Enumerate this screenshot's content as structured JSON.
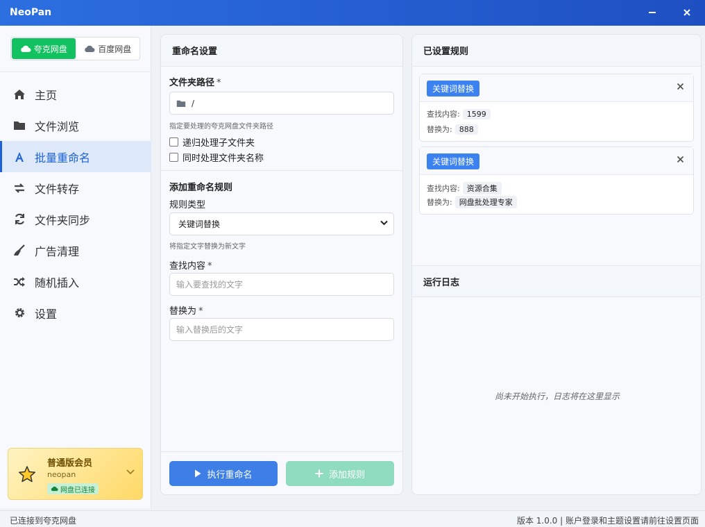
{
  "app": {
    "title": "NeoPan"
  },
  "cloud_switch": {
    "quark": "夸克网盘",
    "baidu": "百度网盘"
  },
  "nav": [
    {
      "label": "主页",
      "icon": "home-icon"
    },
    {
      "label": "文件浏览",
      "icon": "folder-icon"
    },
    {
      "label": "批量重命名",
      "icon": "font-icon",
      "active": true
    },
    {
      "label": "文件转存",
      "icon": "exchange-icon"
    },
    {
      "label": "文件夹同步",
      "icon": "sync-icon"
    },
    {
      "label": "广告清理",
      "icon": "broom-icon"
    },
    {
      "label": "随机插入",
      "icon": "shuffle-icon"
    },
    {
      "label": "设置",
      "icon": "gear-icon"
    }
  ],
  "member": {
    "title": "普通版会员",
    "user": "neopan",
    "badge": "网盘已连接"
  },
  "rename": {
    "title": "重命名设置",
    "folder_label": "文件夹路径",
    "folder_value": "/",
    "folder_hint": "指定要处理的夸克网盘文件夹路径",
    "recursive": "递归处理子文件夹",
    "include_folders": "同时处理文件夹名称",
    "add_rule_title": "添加重命名规则",
    "rule_type_label": "规则类型",
    "rule_type_value": "关键词替换",
    "rule_type_hint": "将指定文字替换为新文字",
    "find_label": "查找内容",
    "find_placeholder": "输入要查找的文字",
    "replace_label": "替换为",
    "replace_placeholder": "输入替换后的文字",
    "run_button": "执行重命名",
    "add_button": "添加规则",
    "required_mark": "*"
  },
  "rules": {
    "title": "已设置规则",
    "find_prefix": "查找内容:",
    "replace_prefix": "替换为:",
    "items": [
      {
        "type": "关键词替换",
        "find": "1599",
        "replace": "888"
      },
      {
        "type": "关键词替换",
        "find": "资源合集",
        "replace": "网盘批处理专家"
      }
    ]
  },
  "log": {
    "title": "运行日志",
    "empty": "尚未开始执行，日志将在这里显示"
  },
  "status": {
    "left": "已连接到夸克网盘",
    "right": "版本 1.0.0 | 账户登录和主题设置请前往设置页面"
  },
  "colors": {
    "primary": "#3d7fe6",
    "active_nav": "#1e63d6",
    "quark_green": "#12c15f",
    "add_button": "#8fdcc0",
    "rule_tag": "#3b82f0"
  }
}
